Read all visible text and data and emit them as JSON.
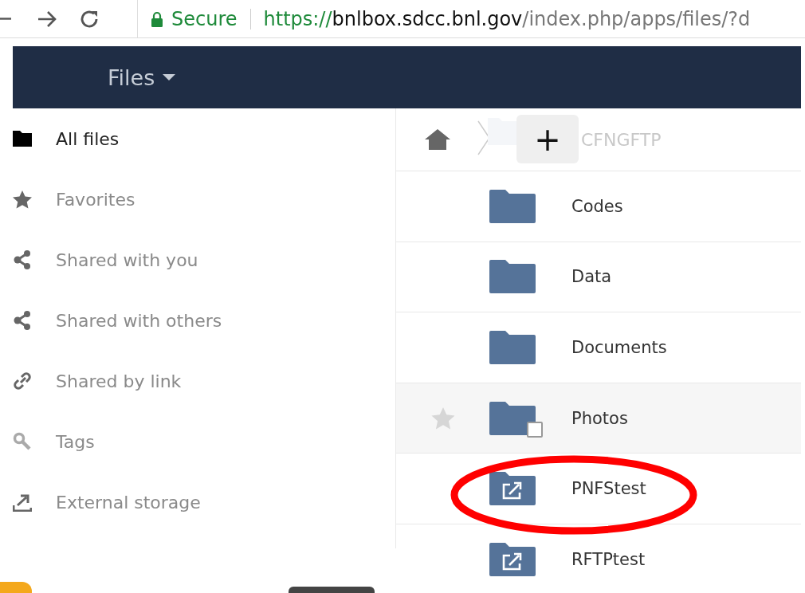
{
  "browser": {
    "secure_label": "Secure",
    "url_scheme": "https://",
    "url_host": "bnlbox.sdcc.bnl.gov",
    "url_path": "/index.php/apps/files/?d"
  },
  "app_menu": {
    "label": "Files"
  },
  "sidebar": {
    "items": [
      {
        "label": "All files",
        "kind": "folder",
        "selected": true
      },
      {
        "label": "Favorites",
        "kind": "star",
        "selected": false
      },
      {
        "label": "Shared with you",
        "kind": "share",
        "selected": false
      },
      {
        "label": "Shared with others",
        "kind": "share",
        "selected": false
      },
      {
        "label": "Shared by link",
        "kind": "link",
        "selected": false
      },
      {
        "label": "Tags",
        "kind": "tag",
        "selected": false
      },
      {
        "label": "External storage",
        "kind": "external",
        "selected": false
      }
    ]
  },
  "breadcrumb": {
    "folder": "CFNGFTP",
    "new_button": "+"
  },
  "files": [
    {
      "name": "Codes",
      "kind": "folder",
      "highlighted": false
    },
    {
      "name": "Data",
      "kind": "folder",
      "highlighted": false
    },
    {
      "name": "Documents",
      "kind": "folder",
      "highlighted": false
    },
    {
      "name": "Photos",
      "kind": "folder",
      "highlighted": true
    },
    {
      "name": "PNFStest",
      "kind": "external",
      "highlighted": false,
      "circled": true
    },
    {
      "name": "RFTPtest",
      "kind": "external",
      "highlighted": false,
      "circled": false
    }
  ]
}
